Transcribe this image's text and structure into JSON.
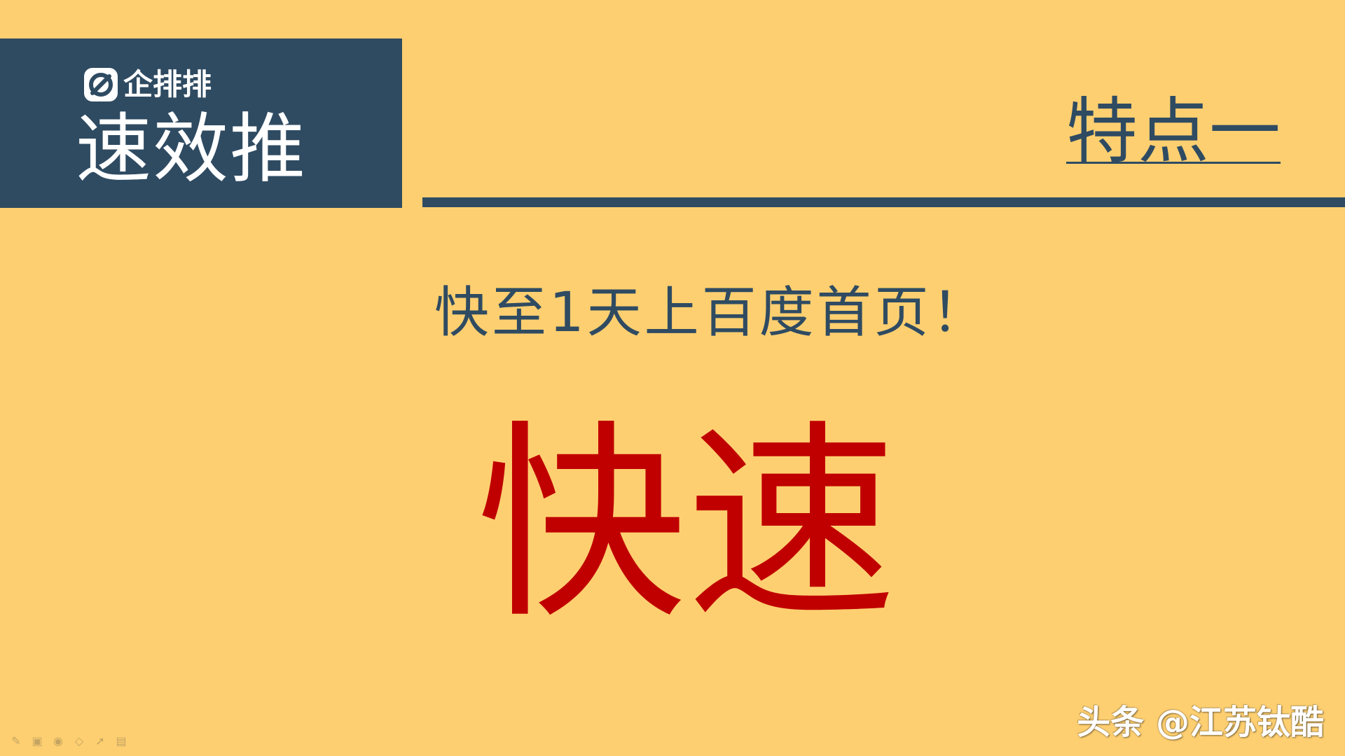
{
  "brand": {
    "logo_icon": "qipaipai-logo-icon",
    "name": "企排排",
    "product": "速效推"
  },
  "slide": {
    "feature_title": "特点一",
    "subtitle": "快至1天上百度首页！",
    "big_word": "快速"
  },
  "watermark": "头条 @江苏钛酷",
  "toolbar": {
    "tools": [
      {
        "name": "pen-icon",
        "glyph": "✎"
      },
      {
        "name": "image-icon",
        "glyph": "▣"
      },
      {
        "name": "eye-icon",
        "glyph": "◉"
      },
      {
        "name": "eraser-icon",
        "glyph": "◇"
      },
      {
        "name": "pointer-icon",
        "glyph": "➚"
      },
      {
        "name": "screen-icon",
        "glyph": "▤"
      }
    ]
  },
  "colors": {
    "background": "#FECF70",
    "navy": "#2F4B62",
    "accent_red": "#C00000",
    "white": "#FFFFFF"
  }
}
